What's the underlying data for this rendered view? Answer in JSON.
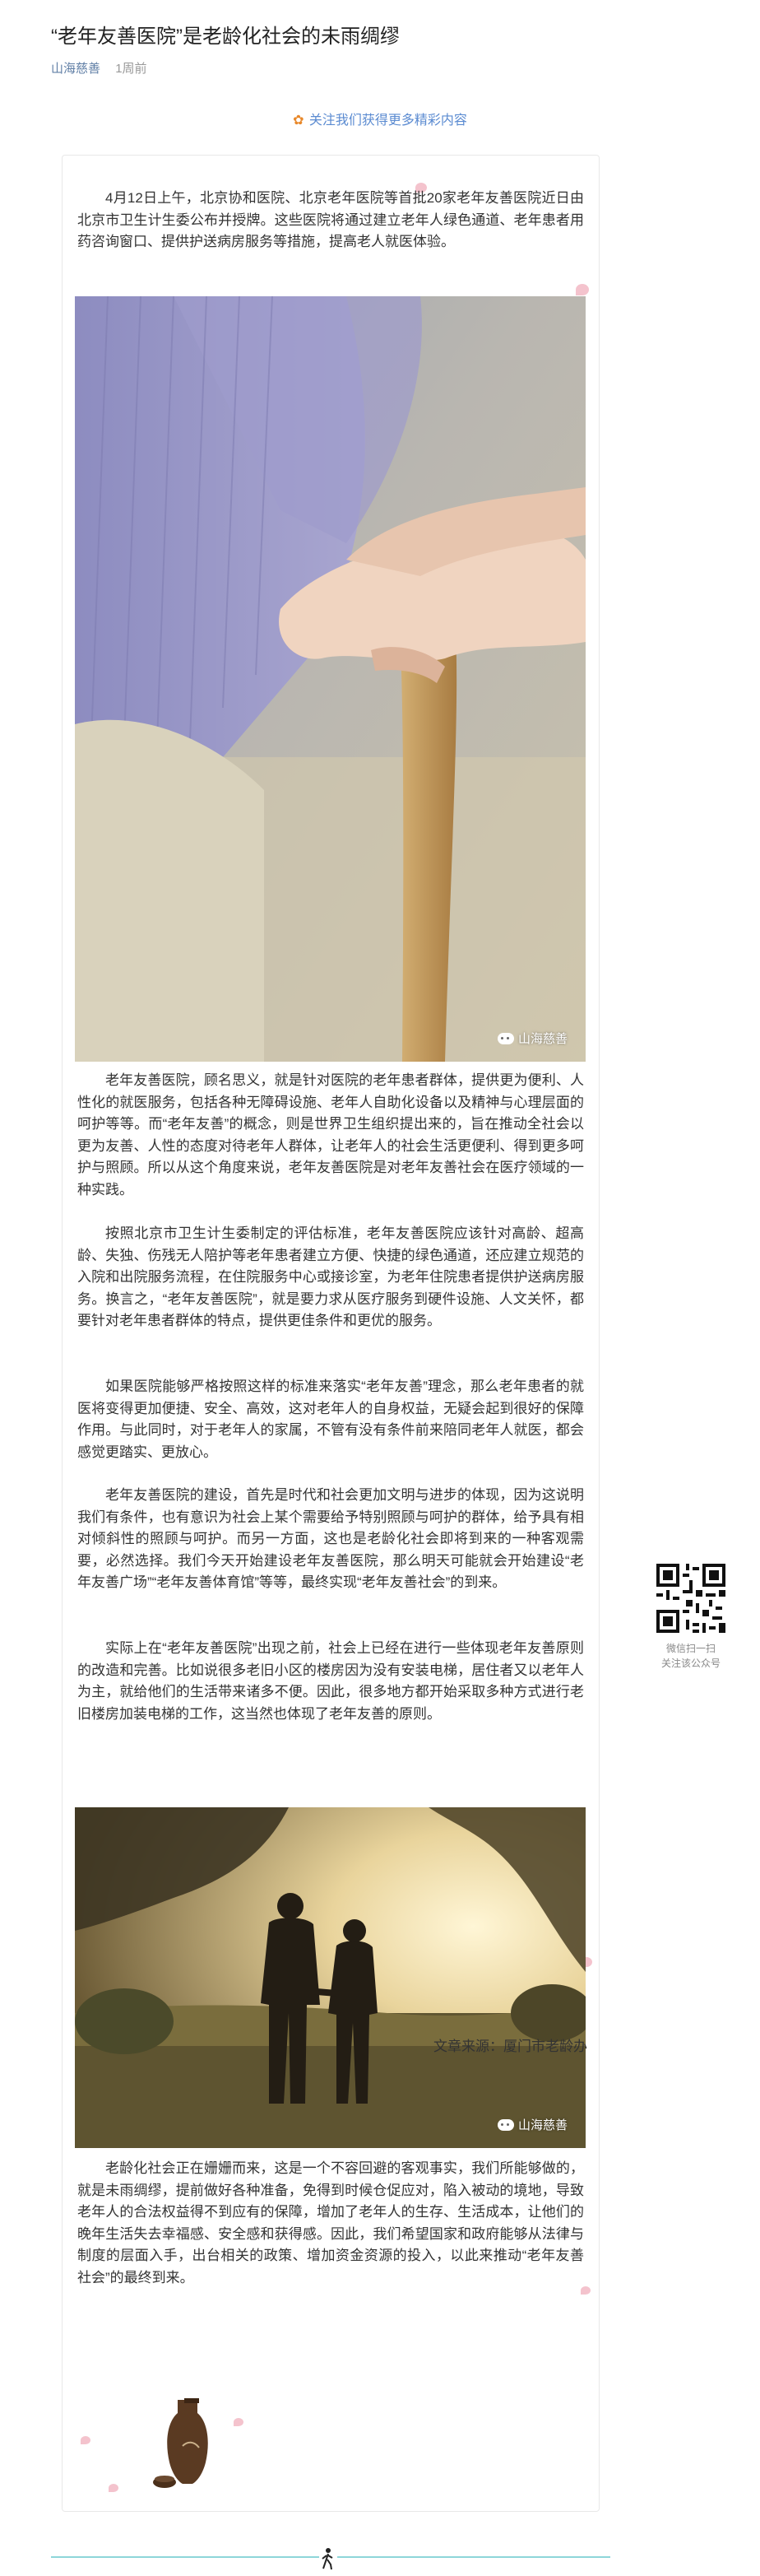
{
  "article": {
    "title": "“老年友善医院”是老龄化社会的未雨绸缪",
    "account": "山海慈善",
    "reads": "1周前"
  },
  "follow_banner": "关注我们获得更多精彩内容",
  "paragraphs": {
    "p1": "4月12日上午，北京协和医院、北京老年医院等首批20家老年友善医院近日由北京市卫生计生委公布并授牌。这些医院将通过建立老年人绿色通道、老年患者用药咨询窗口、提供护送病房服务等措施，提高老人就医体验。",
    "p2": "老年友善医院，顾名思义，就是针对医院的老年患者群体，提供更为便利、人性化的就医服务，包括各种无障碍设施、老年人自助化设备以及精神与心理层面的呵护等等。而“老年友善”的概念，则是世界卫生组织提出来的，旨在推动全社会以更为友善、人性的态度对待老年人群体，让老年人的社会生活更便利、得到更多呵护与照顾。所以从这个角度来说，老年友善医院是对老年友善社会在医疗领域的一种实践。",
    "p3": "按照北京市卫生计生委制定的评估标准，老年友善医院应该针对高龄、超高龄、失独、伤残无人陪护等老年患者建立方便、快捷的绿色通道，还应建立规范的入院和出院服务流程，在住院服务中心或接诊室，为老年住院患者提供护送病房服务。换言之，“老年友善医院”，就是要力求从医疗服务到硬件设施、人文关怀，都要针对老年患者群体的特点，提供更佳条件和更优的服务。",
    "p4": "如果医院能够严格按照这样的标准来落实“老年友善”理念，那么老年患者的就医将变得更加便捷、安全、高效，这对老年人的自身权益，无疑会起到很好的保障作用。与此同时，对于老年人的家属，不管有没有条件前来陪同老年人就医，都会感觉更踏实、更放心。",
    "p5": "老年友善医院的建设，首先是时代和社会更加文明与进步的体现，因为这说明我们有条件，也有意识为社会上某个需要给予特别照顾与呵护的群体，给予具有相对倾斜性的照顾与呵护。而另一方面，这也是老龄化社会即将到来的一种客观需要，必然选择。我们今天开始建设老年友善医院，那么明天可能就会开始建设“老年友善广场”“老年友善体育馆”等等，最终实现“老年友善社会”的到来。",
    "p6": "实际上在“老年友善医院”出现之前，社会上已经在进行一些体现老年友善原则的改造和完善。比如说很多老旧小区的楼房因为没有安装电梯，居住者又以老年人为主，就给他们的生活带来诸多不便。因此，很多地方都开始采取多种方式进行老旧楼房加装电梯的工作，这当然也体现了老年友善的原则。",
    "p7": "老龄化社会正在姗姗而来，这是一个不容回避的客观事实，我们所能够做的，就是未雨绸缪，提前做好各种准备，免得到时候仓促应对，陷入被动的境地，导致老年人的合法权益得不到应有的保障，增加了老年人的生存、生活成本，让他们的晚年生活失去幸福感、安全感和获得感。因此，我们希望国家和政府能够从法律与制度的层面入手，出台相关的政策、增加资金资源的投入，以此来推动“老年友善社会”的最终到来。"
  },
  "images": {
    "cane_watermark": "山海慈善",
    "couple_watermark": "山海慈善"
  },
  "source": "文章来源：厦门市老龄办",
  "qr": {
    "caption_line1": "微信扫一扫",
    "caption_line2": "关注该公众号"
  }
}
